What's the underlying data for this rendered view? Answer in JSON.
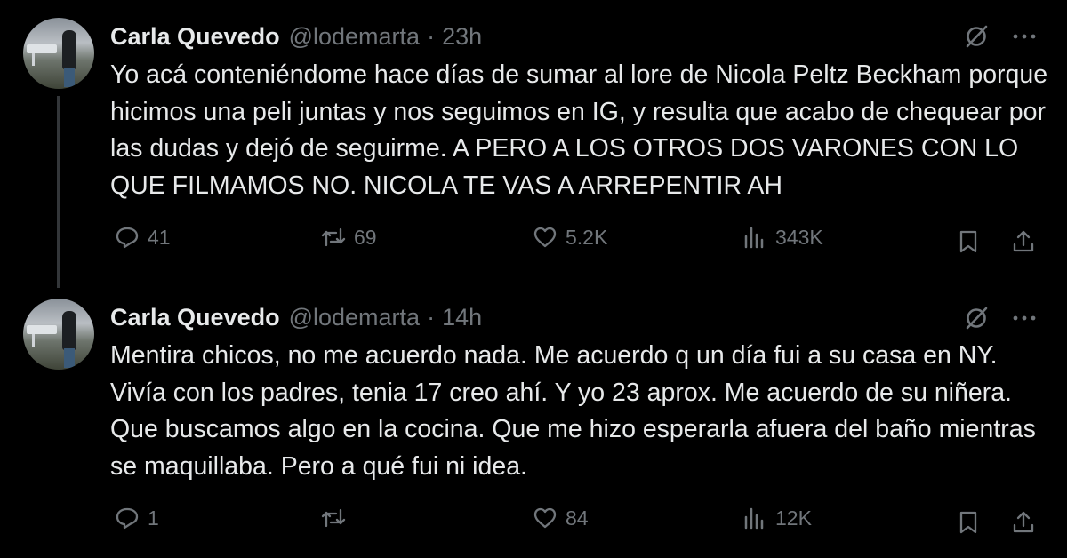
{
  "tweets": [
    {
      "author": "Carla Quevedo",
      "handle": "@lodemarta",
      "separator": "·",
      "time": "23h",
      "text": "Yo acá conteniéndome hace días de sumar al lore de Nicola Peltz Beckham porque hicimos una peli juntas y nos seguimos en IG, y resulta que acabo de chequear por las dudas y dejó de seguirme. A PERO A LOS OTROS DOS VARONES CON LO QUE FILMAMOS NO. NICOLA TE VAS A ARREPENTIR AH",
      "replies": "41",
      "reposts": "69",
      "likes": "5.2K",
      "views": "343K"
    },
    {
      "author": "Carla Quevedo",
      "handle": "@lodemarta",
      "separator": "·",
      "time": "14h",
      "text": "Mentira chicos, no me acuerdo nada. Me acuerdo q un día fui a su casa en NY. Vivía con los padres, tenia 17 creo ahí. Y yo 23 aprox. Me acuerdo de su niñera. Que buscamos algo en la cocina. Que me hizo esperarla afuera del baño mientras se maquillaba. Pero a qué fui ni idea.",
      "replies": "1",
      "reposts": "",
      "likes": "84",
      "views": "12K"
    }
  ],
  "icons": [
    "avatar",
    "grok-icon",
    "more-icon",
    "reply-icon",
    "repost-icon",
    "like-icon",
    "views-icon",
    "bookmark-icon",
    "share-icon"
  ],
  "colors": {
    "background": "#000000",
    "text": "#e7e9ea",
    "muted": "#71767b",
    "thread_line": "#333639"
  }
}
